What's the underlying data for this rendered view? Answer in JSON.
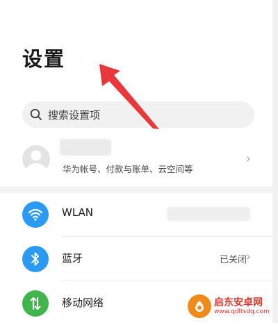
{
  "header": {
    "title": "设置"
  },
  "search": {
    "placeholder": "搜索设置项"
  },
  "account": {
    "subtitle": "华为帐号、付款与账单、云空间等"
  },
  "settings": {
    "items": [
      {
        "label": "WLAN",
        "value": "",
        "icon": "wifi-icon",
        "color": "#2b9af3"
      },
      {
        "label": "蓝牙",
        "value": "已关闭",
        "icon": "bluetooth-icon",
        "color": "#2b9af3"
      },
      {
        "label": "移动网络",
        "value": "",
        "icon": "mobile-data-icon",
        "color": "#3fb54b"
      }
    ]
  },
  "watermark": {
    "title": "启东安卓网",
    "url": "www.qdltsdq.com"
  },
  "colors": {
    "accent": "#2b9af3",
    "green": "#3fb54b",
    "arrow": "#e8383b",
    "watermark": "#d9362b"
  }
}
